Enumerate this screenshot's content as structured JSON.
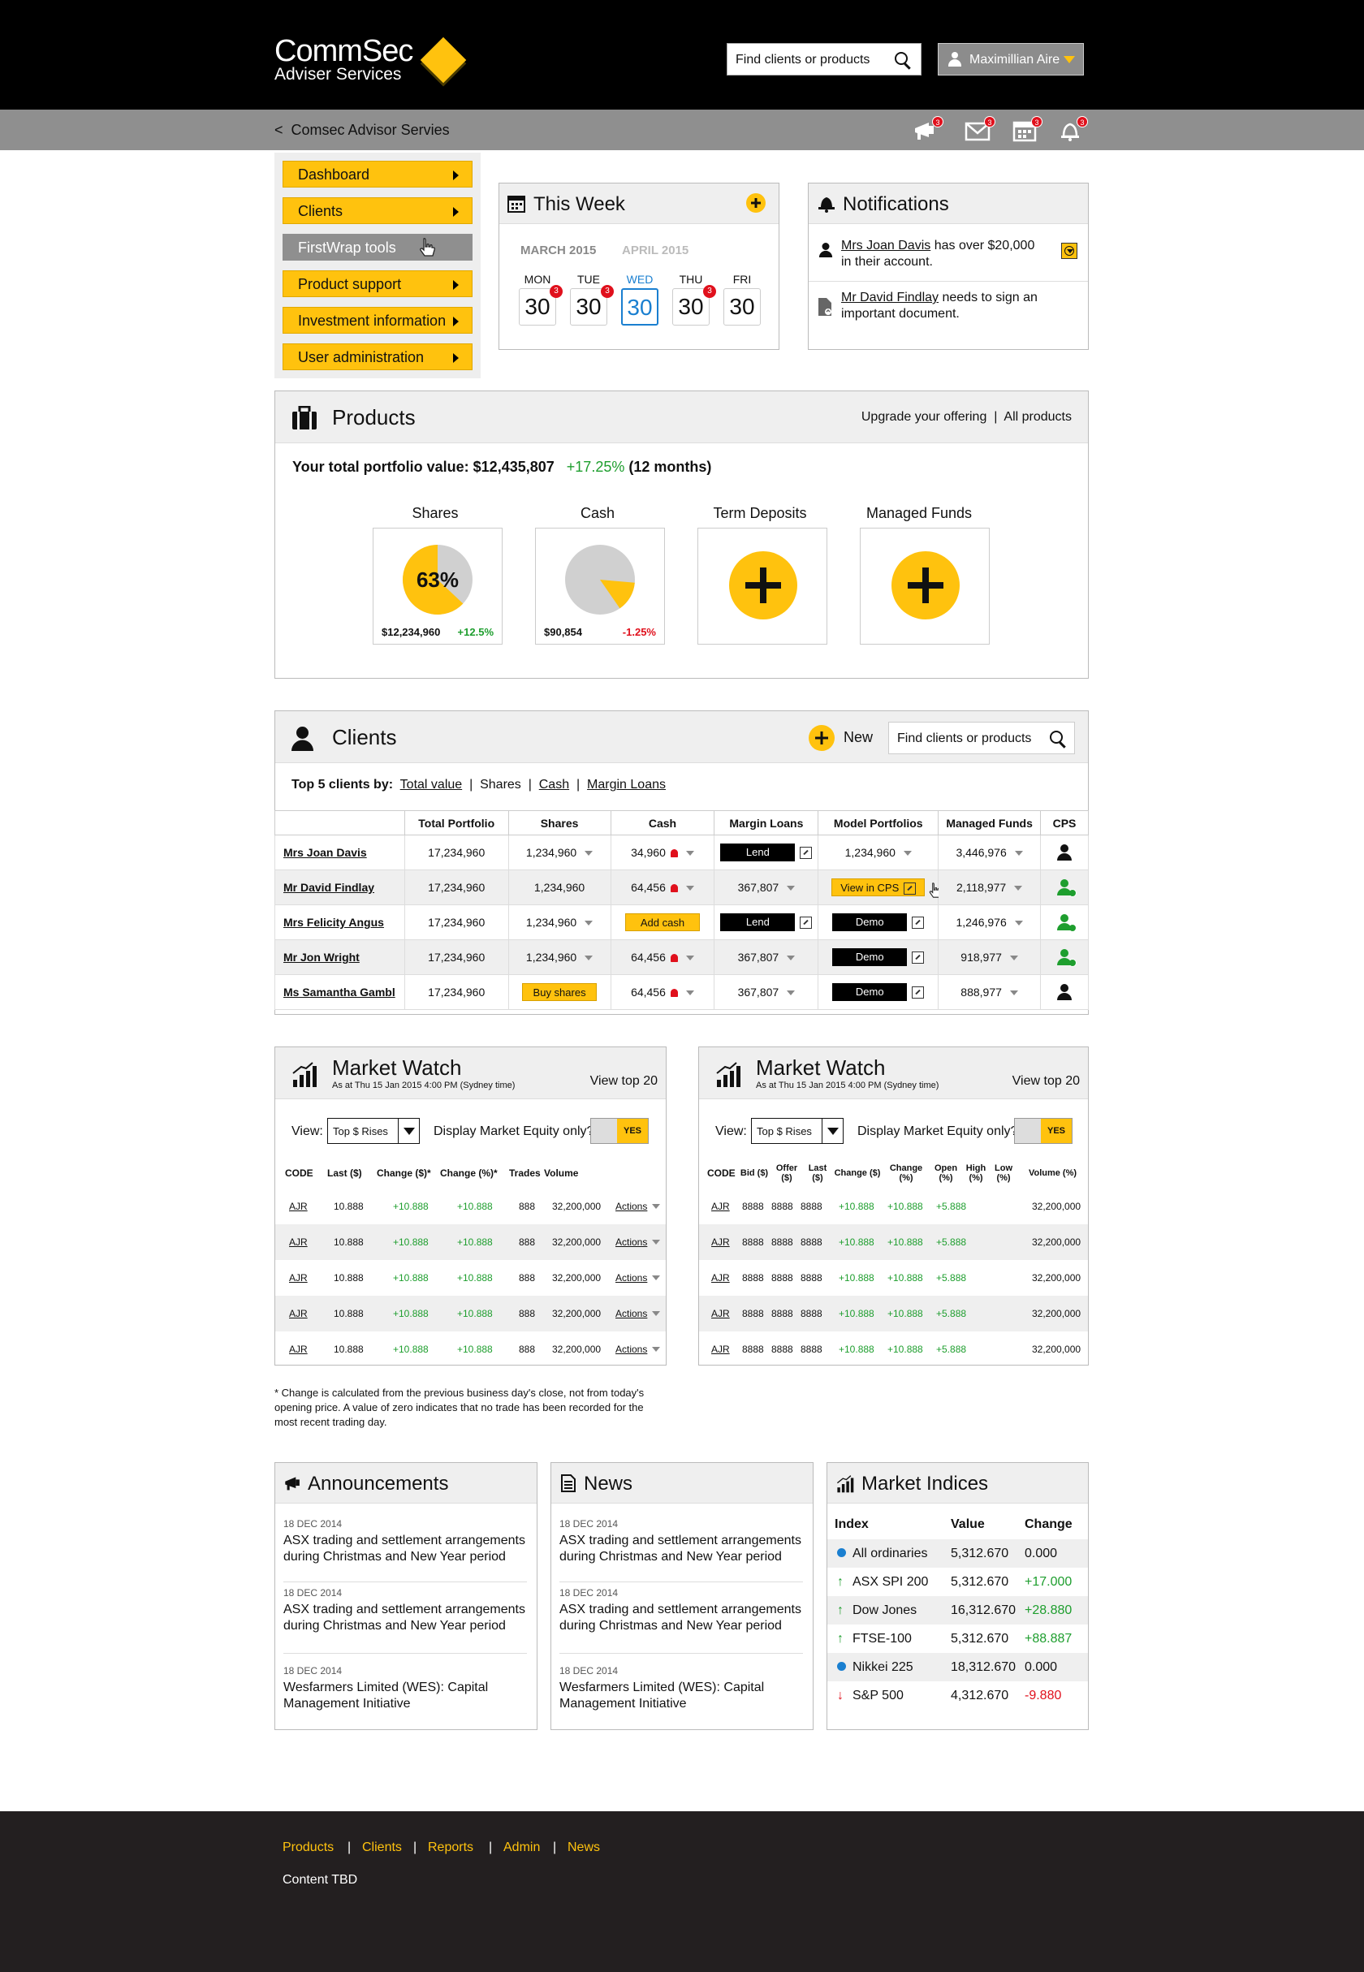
{
  "header": {
    "logo_main": "CommSec",
    "logo_sub": "Adviser Services",
    "search_placeholder": "Find clients or products",
    "user_name": "Maximillian Aire"
  },
  "crumb": {
    "back": "<",
    "label": "Comsec Advisor Servies",
    "icons": [
      {
        "name": "announcements-icon",
        "badge": "3"
      },
      {
        "name": "messages-icon",
        "badge": "3"
      },
      {
        "name": "calendar-icon",
        "badge": "3"
      },
      {
        "name": "notifications-icon",
        "badge": "3"
      }
    ]
  },
  "nav": {
    "items": [
      {
        "label": "Dashboard",
        "state": "active"
      },
      {
        "label": "Clients",
        "state": "active"
      },
      {
        "label": "FirstWrap tools",
        "state": "disabled"
      },
      {
        "label": "Product support",
        "state": "active"
      },
      {
        "label": "Investment information",
        "state": "active"
      },
      {
        "label": "User administration",
        "state": "active"
      }
    ]
  },
  "week": {
    "title": "This Week",
    "months": [
      "MARCH 2015",
      "APRIL 2015"
    ],
    "days": [
      {
        "label": "MON",
        "num": "30",
        "badge": "3"
      },
      {
        "label": "TUE",
        "num": "30",
        "badge": "3"
      },
      {
        "label": "WED",
        "num": "30",
        "badge": ""
      },
      {
        "label": "THU",
        "num": "30",
        "badge": "3"
      },
      {
        "label": "FRI",
        "num": "30",
        "badge": ""
      }
    ]
  },
  "notifications": {
    "title": "Notifications",
    "items": [
      {
        "link": "Mrs Joan Davis",
        "text1": " has over $20,000",
        "text2": "in their account."
      },
      {
        "link": "Mr David Findlay",
        "text1": " needs to sign an",
        "text2": "important document."
      }
    ]
  },
  "products": {
    "title": "Products",
    "links": [
      "Upgrade your offering",
      "|",
      "All products"
    ],
    "portfolio_label": "Your total portfolio value: $12,435,807",
    "portfolio_change": "+17.25%",
    "portfolio_period": "(12 months)",
    "tiles": [
      {
        "label": "Shares",
        "pct_text": "63%",
        "value": "$12,234,960",
        "change": "+12.5%",
        "fraction": 0.63
      },
      {
        "label": "Cash",
        "value": "$90,854",
        "change": "-1.25%",
        "fraction": 0.14
      },
      {
        "label": "Term Deposits"
      },
      {
        "label": "Managed Funds"
      }
    ]
  },
  "clients": {
    "title": "Clients",
    "new_label": "New",
    "search_placeholder": "Find clients or products",
    "top5_label": "Top 5 clients by:",
    "top5_links": [
      "Total value",
      "|",
      "Shares",
      "|",
      "Cash",
      "|",
      "Margin Loans"
    ],
    "columns": [
      "",
      "Total Portfolio",
      "Shares",
      "Cash",
      "Margin Loans",
      "Model Portfolios",
      "Managed Funds",
      "CPS"
    ],
    "rows": [
      {
        "name": "Mrs Joan Davis",
        "total": "17,234,960",
        "shares": "1,234,960",
        "cash": "34,960",
        "margin": "Lend",
        "model": "1,234,960",
        "funds": "3,446,976"
      },
      {
        "name": "Mr David Findlay",
        "total": "17,234,960",
        "shares": "1,234,960",
        "cash": "64,456",
        "margin": "367,807",
        "model": "View in CPS",
        "funds": "2,118,977"
      },
      {
        "name": "Mrs Felicity Angus",
        "total": "17,234,960",
        "shares": "1,234,960",
        "cash": "Add cash",
        "margin": "Lend",
        "model": "Demo",
        "funds": "1,246,976"
      },
      {
        "name": "Mr Jon Wright",
        "total": "17,234,960",
        "shares": "1,234,960",
        "cash": "64,456",
        "margin": "367,807",
        "model": "Demo",
        "funds": "918,977"
      },
      {
        "name": "Ms Samantha Gambl",
        "total": "17,234,960",
        "shares": "Buy shares",
        "cash": "64,456",
        "margin": "367,807",
        "model": "Demo",
        "funds": "888,977"
      }
    ]
  },
  "market_watch_left": {
    "title": "Market Watch",
    "asof": "As at Thu 15 Jan 2015 4:00 PM (Sydney time)",
    "view_top": "View top 20",
    "view_label": "View:",
    "select": "Top $ Rises",
    "equity_label": "Display Market Equity only?",
    "toggle": "YES",
    "columns": [
      "CODE",
      "Last ($)",
      "Change ($)*",
      "Change (%)*",
      "Trades",
      "Volume",
      ""
    ],
    "rows": [
      {
        "code": "AJR",
        "last": "10.888",
        "chg": "+10.888",
        "pct": "+10.888",
        "trades": "888",
        "vol": "32,200,000",
        "act": "Actions"
      },
      {
        "code": "AJR",
        "last": "10.888",
        "chg": "+10.888",
        "pct": "+10.888",
        "trades": "888",
        "vol": "32,200,000",
        "act": "Actions"
      },
      {
        "code": "AJR",
        "last": "10.888",
        "chg": "+10.888",
        "pct": "+10.888",
        "trades": "888",
        "vol": "32,200,000",
        "act": "Actions"
      },
      {
        "code": "AJR",
        "last": "10.888",
        "chg": "+10.888",
        "pct": "+10.888",
        "trades": "888",
        "vol": "32,200,000",
        "act": "Actions"
      },
      {
        "code": "AJR",
        "last": "10.888",
        "chg": "+10.888",
        "pct": "+10.888",
        "trades": "888",
        "vol": "32,200,000",
        "act": "Actions"
      }
    ]
  },
  "market_watch_right": {
    "title": "Market Watch",
    "asof": "As at Thu 15 Jan 2015 4:00 PM (Sydney time)",
    "view_top": "View top 20",
    "view_label": "View:",
    "select": "Top $ Rises",
    "equity_label": "Display Market Equity only?",
    "toggle": "YES",
    "columns": [
      "CODE",
      "Bid ($)",
      "Offer ($)",
      "Last ($)",
      "Change ($)",
      "Change (%)",
      "Open (%)",
      "High (%)",
      "Low (%)",
      "Volume (%)"
    ],
    "rows": [
      {
        "code": "AJR",
        "bid": "8888",
        "offer": "8888",
        "last": "8888",
        "chg": "+10.888",
        "pct": "+10.888",
        "open": "+5.888",
        "vol": "32,200,000"
      },
      {
        "code": "AJR",
        "bid": "8888",
        "offer": "8888",
        "last": "8888",
        "chg": "+10.888",
        "pct": "+10.888",
        "open": "+5.888",
        "vol": "32,200,000"
      },
      {
        "code": "AJR",
        "bid": "8888",
        "offer": "8888",
        "last": "8888",
        "chg": "+10.888",
        "pct": "+10.888",
        "open": "+5.888",
        "vol": "32,200,000"
      },
      {
        "code": "AJR",
        "bid": "8888",
        "offer": "8888",
        "last": "8888",
        "chg": "+10.888",
        "pct": "+10.888",
        "open": "+5.888",
        "vol": "32,200,000"
      },
      {
        "code": "AJR",
        "bid": "8888",
        "offer": "8888",
        "last": "8888",
        "chg": "+10.888",
        "pct": "+10.888",
        "open": "+5.888",
        "vol": "32,200,000"
      }
    ]
  },
  "footnote": [
    "* Change is calculated from the previous business day's close, not from today's",
    "opening price. A value of zero indicates that no trade has been recorded for the",
    "most recent trading day."
  ],
  "announcements": {
    "title": "Announcements",
    "items": [
      {
        "date": "18 DEC 2014",
        "line1": "ASX trading and settlement arrangements",
        "line2": "during Christmas and New Year period"
      },
      {
        "date": "18 DEC 2014",
        "line1": "ASX trading and settlement arrangements",
        "line2": "during Christmas and New Year period"
      },
      {
        "date": "18 DEC 2014",
        "line1": "Wesfarmers Limited (WES): Capital",
        "line2": "Management Initiative"
      }
    ]
  },
  "news": {
    "title": "News",
    "items": [
      {
        "date": "18 DEC 2014",
        "line1": "ASX trading and settlement arrangements",
        "line2": "during Christmas and New Year period"
      },
      {
        "date": "18 DEC 2014",
        "line1": "ASX trading and settlement arrangements",
        "line2": "during Christmas and New Year period"
      },
      {
        "date": "18 DEC 2014",
        "line1": "Wesfarmers Limited (WES): Capital",
        "line2": "Management Initiative"
      }
    ]
  },
  "indices": {
    "title": "Market Indices",
    "columns": [
      "Index",
      "Value",
      "Change"
    ],
    "rows": [
      {
        "name": "All ordinaries",
        "value": "5,312.670",
        "change": "0.000",
        "trend": "flat"
      },
      {
        "name": "ASX SPI 200",
        "value": "5,312.670",
        "change": "+17.000",
        "trend": "up"
      },
      {
        "name": "Dow Jones",
        "value": "16,312.670",
        "change": "+28.880",
        "trend": "up"
      },
      {
        "name": "FTSE-100",
        "value": "5,312.670",
        "change": "+88.887",
        "trend": "up"
      },
      {
        "name": "Nikkei 225",
        "value": "18,312.670",
        "change": "0.000",
        "trend": "flat"
      },
      {
        "name": "S&P 500",
        "value": "4,312.670",
        "change": "-9.880",
        "trend": "down"
      }
    ]
  },
  "footer": {
    "links": [
      "Products",
      "Clients",
      "Reports",
      "Admin",
      "News"
    ],
    "content": "Content TBD"
  },
  "colors": {
    "accent": "#ffc20e",
    "positive": "#1e9e2e",
    "negative": "#e0101c",
    "link_blue": "#1a7fd0"
  }
}
